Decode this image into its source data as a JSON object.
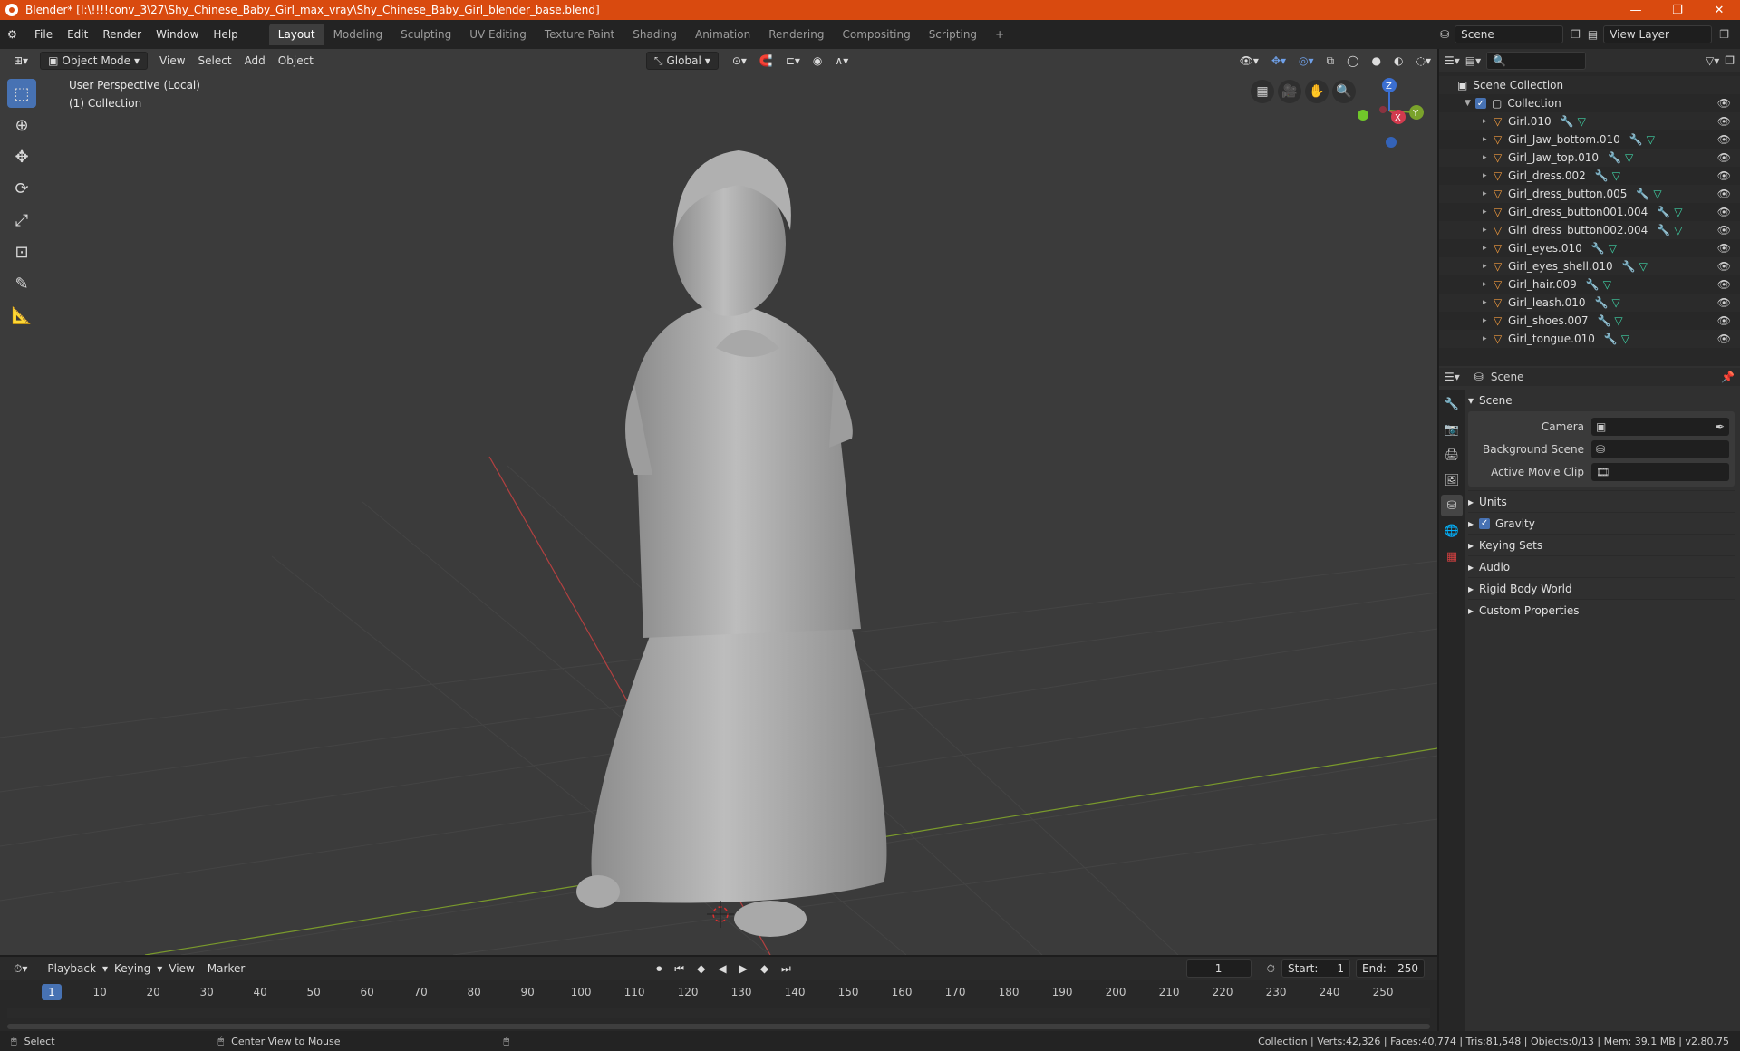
{
  "window": {
    "title": "Blender* [I:\\!!!!conv_3\\27\\Shy_Chinese_Baby_Girl_max_vray\\Shy_Chinese_Baby_Girl_blender_base.blend]",
    "min": "—",
    "max": "❐",
    "close": "✕"
  },
  "menu": [
    "File",
    "Edit",
    "Render",
    "Window",
    "Help"
  ],
  "workspaces": [
    "Layout",
    "Modeling",
    "Sculpting",
    "UV Editing",
    "Texture Paint",
    "Shading",
    "Animation",
    "Rendering",
    "Compositing",
    "Scripting"
  ],
  "workspace_add": "+",
  "scene_field": "Scene",
  "view_layer_field": "View Layer",
  "viewport": {
    "mode": "Object Mode",
    "menus": [
      "View",
      "Select",
      "Add",
      "Object"
    ],
    "transform_orientation": "Global",
    "info_line1": "User Perspective (Local)",
    "info_line2": "(1) Collection",
    "gizmo": {
      "z": "Z",
      "x": "X",
      "y": "Y"
    }
  },
  "outliner": {
    "root": "Scene Collection",
    "collection": "Collection",
    "objects": [
      "Girl.010",
      "Girl_Jaw_bottom.010",
      "Girl_Jaw_top.010",
      "Girl_dress.002",
      "Girl_dress_button.005",
      "Girl_dress_button001.004",
      "Girl_dress_button002.004",
      "Girl_eyes.010",
      "Girl_eyes_shell.010",
      "Girl_hair.009",
      "Girl_leash.010",
      "Girl_shoes.007",
      "Girl_tongue.010"
    ]
  },
  "properties": {
    "header": "Scene",
    "panel": "Scene",
    "rows": [
      {
        "label": "Camera",
        "value": ""
      },
      {
        "label": "Background Scene",
        "value": ""
      },
      {
        "label": "Active Movie Clip",
        "value": ""
      }
    ],
    "sections": [
      "Units",
      "Gravity",
      "Keying Sets",
      "Audio",
      "Rigid Body World",
      "Custom Properties"
    ]
  },
  "timeline": {
    "menus": [
      "Playback",
      "Keying",
      "View",
      "Marker"
    ],
    "current_frame": "1",
    "start_label": "Start:",
    "start": "1",
    "end_label": "End:",
    "end": "250",
    "ticks": [
      "1",
      "10",
      "20",
      "30",
      "40",
      "50",
      "60",
      "70",
      "80",
      "90",
      "100",
      "110",
      "120",
      "130",
      "140",
      "150",
      "160",
      "170",
      "180",
      "190",
      "200",
      "210",
      "220",
      "230",
      "240",
      "250"
    ]
  },
  "status": {
    "select": "Select",
    "center": "Center View to Mouse",
    "stats": "Collection | Verts:42,326 | Faces:40,774 | Tris:81,548 | Objects:0/13 | Mem: 39.1 MB | v2.80.75"
  }
}
